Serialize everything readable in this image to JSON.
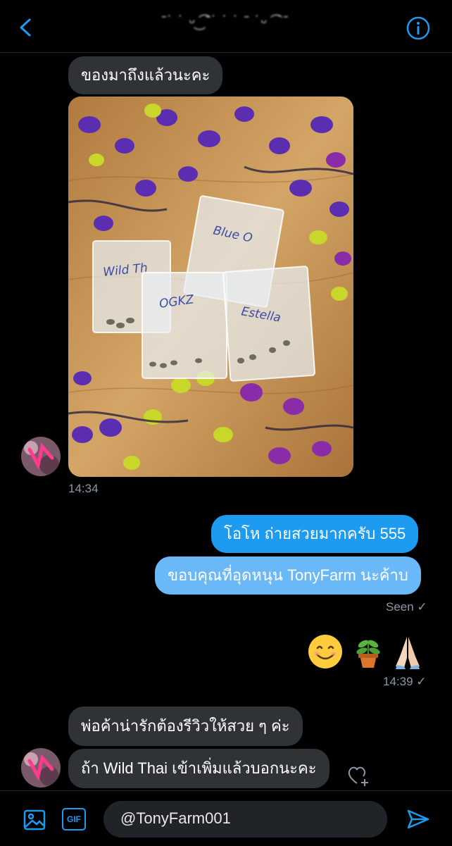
{
  "header": {
    "title": "ˉ˙ ˙ ᵕ͜ ͡ ˉ˙ ˙ ˙  ˉ ˙ᵕ ͡ ˙ˉ"
  },
  "messages": {
    "m1": "ของมาถึงแล้วนะคะ",
    "photo_bag_labels": [
      "Wild Th",
      "Blue O",
      "OGKZ",
      "Estella"
    ],
    "time1": "14:34",
    "m2": "โอโห ถ่ายสวยมากครับ 555",
    "m3": "ขอบคุณที่อุดหนุน TonyFarm นะค้าบ",
    "seen": "Seen ✓",
    "emoji_row": [
      "smiling-face",
      "potted-plant",
      "folded-hands"
    ],
    "time2": "14:39 ✓",
    "m4": "พ่อค้าน่ารักต้องรีวิวให้สวย ๆ ค่ะ",
    "m5": "ถ้า Wild Thai เข้าเพิ่มแล้วบอกนะคะ"
  },
  "composer": {
    "text": "@TonyFarm001",
    "gif_label": "GIF"
  },
  "colors": {
    "accent": "#1d9bf0",
    "bubble_recv": "#2f3336",
    "bg": "#000000"
  }
}
